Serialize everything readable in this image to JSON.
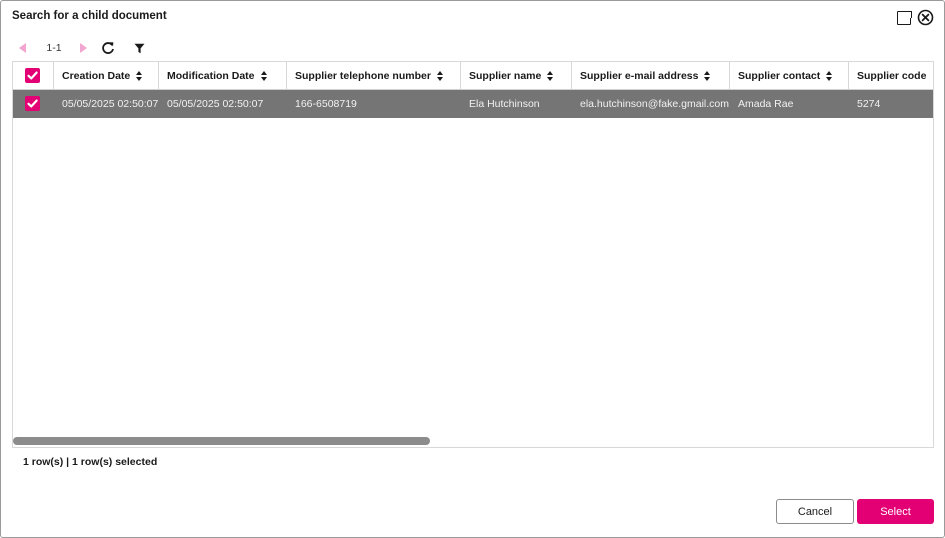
{
  "dialog": {
    "title": "Search for a child document"
  },
  "toolbar": {
    "page_indicator": "1-1",
    "icons": [
      "prev-page-icon",
      "next-page-icon",
      "refresh-icon",
      "filter-icon"
    ]
  },
  "table": {
    "columns": [
      "Creation Date",
      "Modification Date",
      "Supplier telephone number",
      "Supplier name",
      "Supplier e-mail address",
      "Supplier contact",
      "Supplier code"
    ],
    "rows": [
      {
        "selected": true,
        "cells": [
          "05/05/2025 02:50:07",
          "05/05/2025 02:50:07",
          "166-6508719",
          "Ela Hutchinson",
          "ela.hutchinson@fake.gmail.com",
          "Amada Rae",
          "5274"
        ]
      }
    ]
  },
  "footer": {
    "row_count": "1 row(s) | 1 row(s) selected",
    "cancel_label": "Cancel",
    "select_label": "Select"
  },
  "colors": {
    "accent": "#e20074",
    "accent_light": "#f2a6cf",
    "selected_row": "#757575"
  }
}
